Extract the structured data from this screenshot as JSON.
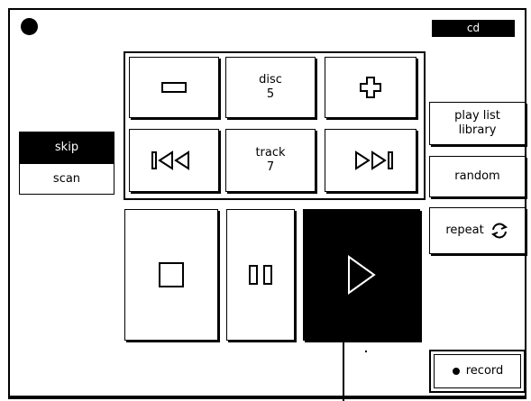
{
  "header": {
    "mode_tab": "cd"
  },
  "disc": {
    "caption": "disc",
    "value": "5"
  },
  "track": {
    "caption": "track",
    "value": "7"
  },
  "seek_mode": {
    "skip_label": "skip",
    "scan_label": "scan",
    "selected": "skip"
  },
  "side": {
    "playlist_line1": "play list",
    "playlist_line2": "library",
    "random_label": "random",
    "repeat_label": "repeat",
    "record_label": "record"
  },
  "icons": {
    "power": "filled-circle-icon",
    "minus": "minus-icon",
    "plus": "plus-icon",
    "previous": "previous-track-icon",
    "next": "next-track-icon",
    "stop": "stop-icon",
    "pause": "pause-icon",
    "play": "play-icon",
    "repeat": "repeat-arrows-icon",
    "record": "record-dot-icon"
  },
  "colors": {
    "foreground": "#000000",
    "background": "#ffffff"
  }
}
